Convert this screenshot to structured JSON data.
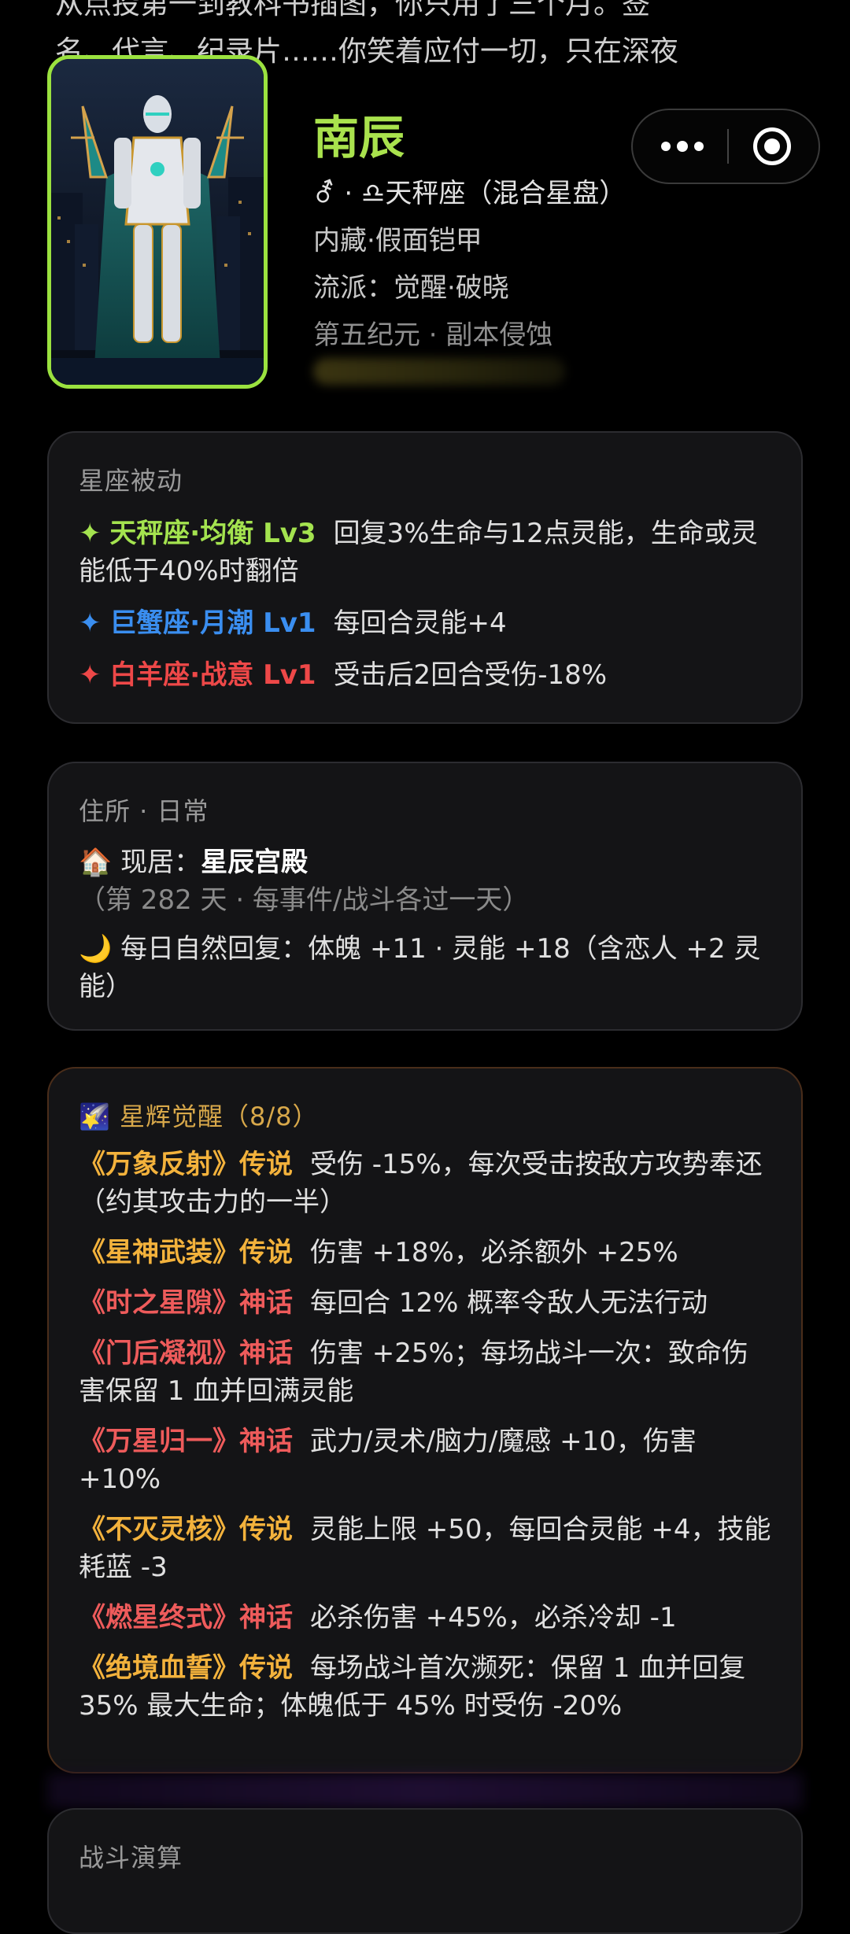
{
  "top_text": {
    "line1": "从点投第一到教科书插图，你只用了三个月。签",
    "line2": "名、代言、纪录片……你笑着应付一切，只在深夜"
  },
  "profile": {
    "name": "南辰",
    "gender_symbol": "⚦",
    "sign_line": "· ♎天秤座（混合星盘）",
    "trait": "内藏·假面铠甲",
    "style": "流派：觉醒·破晓",
    "era": "第五纪元 · 副本侵蚀"
  },
  "passive": {
    "title": "星座被动",
    "items": [
      {
        "icon": "✦",
        "name": "天秤座·均衡 Lv3",
        "desc": "回复3%生命与12点灵能，生命或灵能低于40%时翻倍",
        "color": "#a4e34f"
      },
      {
        "icon": "✦",
        "name": "巨蟹座·月潮 Lv1",
        "desc": "每回合灵能+4",
        "color": "#3a8ef0"
      },
      {
        "icon": "✦",
        "name": "白羊座·战意 Lv1",
        "desc": "受击后2回合受伤-18%",
        "color": "#ee4848"
      }
    ]
  },
  "residence": {
    "title": "住所 · 日常",
    "home_icon": "🏠",
    "home_label": "现居：",
    "home_name": "星辰宫殿",
    "home_note": "（第 282 天 · 每事件/战斗各过一天）",
    "moon_icon": "🌙",
    "recovery": "每日自然回复：体魄 +11 · 灵能 +18（含恋人 +2 灵能）"
  },
  "awaken": {
    "icon": "🌠",
    "title": "星辉觉醒（8/8）",
    "items": [
      {
        "name": "《万象反射》传说",
        "desc": "受伤 -15%，每次受击按敌方攻势奉还（约其攻击力的一半）",
        "color": "#f3b23c"
      },
      {
        "name": "《星神武装》传说",
        "desc": "伤害 +18%，必杀额外 +25%",
        "color": "#f3b23c"
      },
      {
        "name": "《时之星隙》神话",
        "desc": "每回合 12% 概率令敌人无法行动",
        "color": "#ee5b5b"
      },
      {
        "name": "《门后凝视》神话",
        "desc": "伤害 +25%；每场战斗一次：致命伤害保留 1 血并回满灵能",
        "color": "#ee5b5b"
      },
      {
        "name": "《万星归一》神话",
        "desc": "武力/灵术/脑力/魔感 +10，伤害 +10%",
        "color": "#ee5b5b"
      },
      {
        "name": "《不灭灵核》传说",
        "desc": "灵能上限 +50，每回合灵能 +4，技能耗蓝 -3",
        "color": "#f3b23c"
      },
      {
        "name": "《燃星终式》神话",
        "desc": "必杀伤害 +45%，必杀冷却 -1",
        "color": "#ee5b5b"
      },
      {
        "name": "《绝境血誓》传说",
        "desc": "每场战斗首次濒死：保留 1 血并回复 35% 最大生命；体魄低于 45% 时受伤 -20%",
        "color": "#f3b23c"
      }
    ]
  },
  "battle": {
    "title": "战斗演算"
  },
  "colors": {
    "accent_green": "#9be23f",
    "card_bg": "#141416"
  }
}
